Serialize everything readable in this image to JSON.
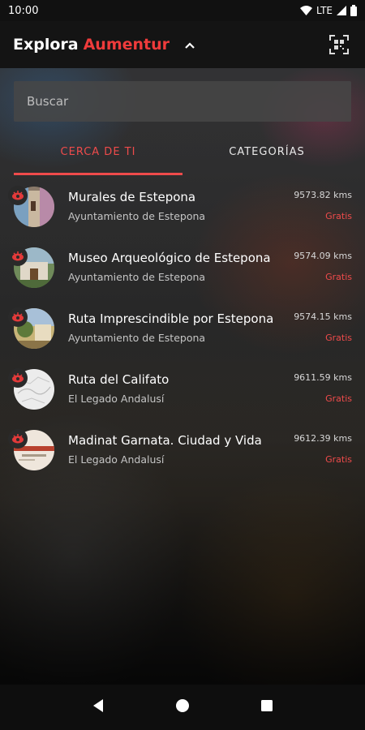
{
  "status_bar": {
    "time": "10:00",
    "network": "LTE"
  },
  "app_bar": {
    "title_prefix": "Explora",
    "title_brand": "Aumentur"
  },
  "search": {
    "placeholder": "Buscar"
  },
  "tabs": [
    {
      "label": "CERCA DE TI",
      "active": true
    },
    {
      "label": "CATEGORÍAS",
      "active": false
    }
  ],
  "items": [
    {
      "title": "Murales de Estepona",
      "subtitle": "Ayuntamiento de Estepona",
      "distance": "9573.82 kms",
      "price": "Gratis"
    },
    {
      "title": "Museo Arqueológico de Estepona",
      "subtitle": "Ayuntamiento de Estepona",
      "distance": "9574.09 kms",
      "price": "Gratis"
    },
    {
      "title": "Ruta Imprescindible por Estepona",
      "subtitle": "Ayuntamiento de Estepona",
      "distance": "9574.15 kms",
      "price": "Gratis"
    },
    {
      "title": "Ruta del Califato",
      "subtitle": "El Legado Andalusí",
      "distance": "9611.59 kms",
      "price": "Gratis"
    },
    {
      "title": "Madinat Garnata. Ciudad y Vida",
      "subtitle": "El Legado Andalusí",
      "distance": "9612.39 kms",
      "price": "Gratis"
    }
  ],
  "colors": {
    "accent": "#ef4b4b",
    "app_bar": "#141414"
  }
}
